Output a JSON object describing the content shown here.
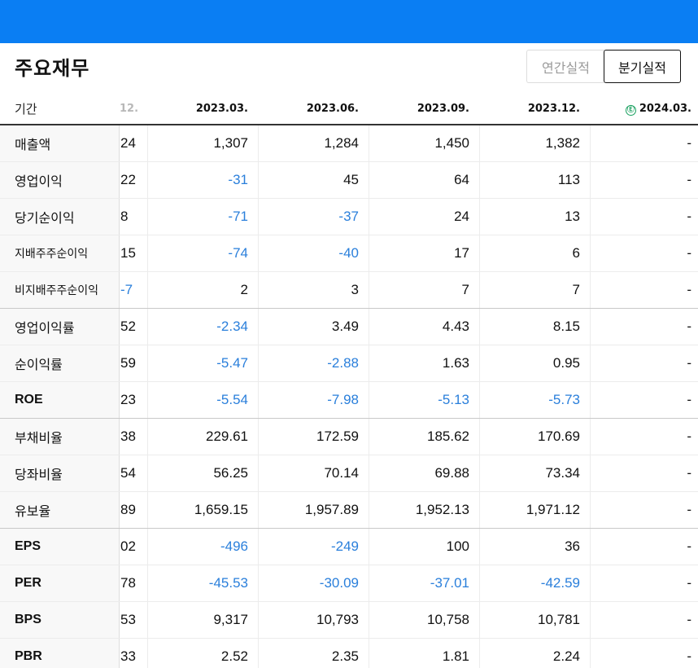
{
  "section_title": "주요재무",
  "toggles": {
    "annual": "연간실적",
    "quarterly": "분기실적"
  },
  "header": {
    "label": "기간",
    "columns": [
      "12.",
      "2023.03.",
      "2023.06.",
      "2023.09.",
      "2023.12.",
      "2024.03."
    ],
    "estimate_icon": "Ⓔ"
  },
  "rows": [
    {
      "name": "매출액",
      "values": [
        "24",
        "1,307",
        "1,284",
        "1,450",
        "1,382",
        "-"
      ]
    },
    {
      "name": "영업이익",
      "values": [
        "22",
        "-31",
        "45",
        "64",
        "113",
        "-"
      ]
    },
    {
      "name": "당기순이익",
      "values": [
        "8",
        "-71",
        "-37",
        "24",
        "13",
        "-"
      ]
    },
    {
      "name": "지배주주순이익",
      "values": [
        "15",
        "-74",
        "-40",
        "17",
        "6",
        "-"
      ]
    },
    {
      "name": "비지배주주순이익",
      "values": [
        "-7",
        "2",
        "3",
        "7",
        "7",
        "-"
      ]
    },
    {
      "name": "영업이익률",
      "values": [
        "52",
        "-2.34",
        "3.49",
        "4.43",
        "8.15",
        "-"
      ]
    },
    {
      "name": "순이익률",
      "values": [
        "59",
        "-5.47",
        "-2.88",
        "1.63",
        "0.95",
        "-"
      ]
    },
    {
      "name": "ROE",
      "values": [
        "23",
        "-5.54",
        "-7.98",
        "-5.13",
        "-5.73",
        "-"
      ]
    },
    {
      "name": "부채비율",
      "values": [
        "38",
        "229.61",
        "172.59",
        "185.62",
        "170.69",
        "-"
      ]
    },
    {
      "name": "당좌비율",
      "values": [
        "54",
        "56.25",
        "70.14",
        "69.88",
        "73.34",
        "-"
      ]
    },
    {
      "name": "유보율",
      "values": [
        "89",
        "1,659.15",
        "1,957.89",
        "1,952.13",
        "1,971.12",
        "-"
      ]
    },
    {
      "name": "EPS",
      "values": [
        "02",
        "-496",
        "-249",
        "100",
        "36",
        "-"
      ]
    },
    {
      "name": "PER",
      "values": [
        "78",
        "-45.53",
        "-30.09",
        "-37.01",
        "-42.59",
        "-"
      ]
    },
    {
      "name": "BPS",
      "values": [
        "53",
        "9,317",
        "10,793",
        "10,758",
        "10,781",
        "-"
      ]
    },
    {
      "name": "PBR",
      "values": [
        "33",
        "2.52",
        "2.35",
        "1.81",
        "2.24",
        "-"
      ]
    }
  ],
  "colors": {
    "topbar": "#0a7ef3",
    "negative": "#2a7fdb",
    "estimate": "#19a05f"
  }
}
